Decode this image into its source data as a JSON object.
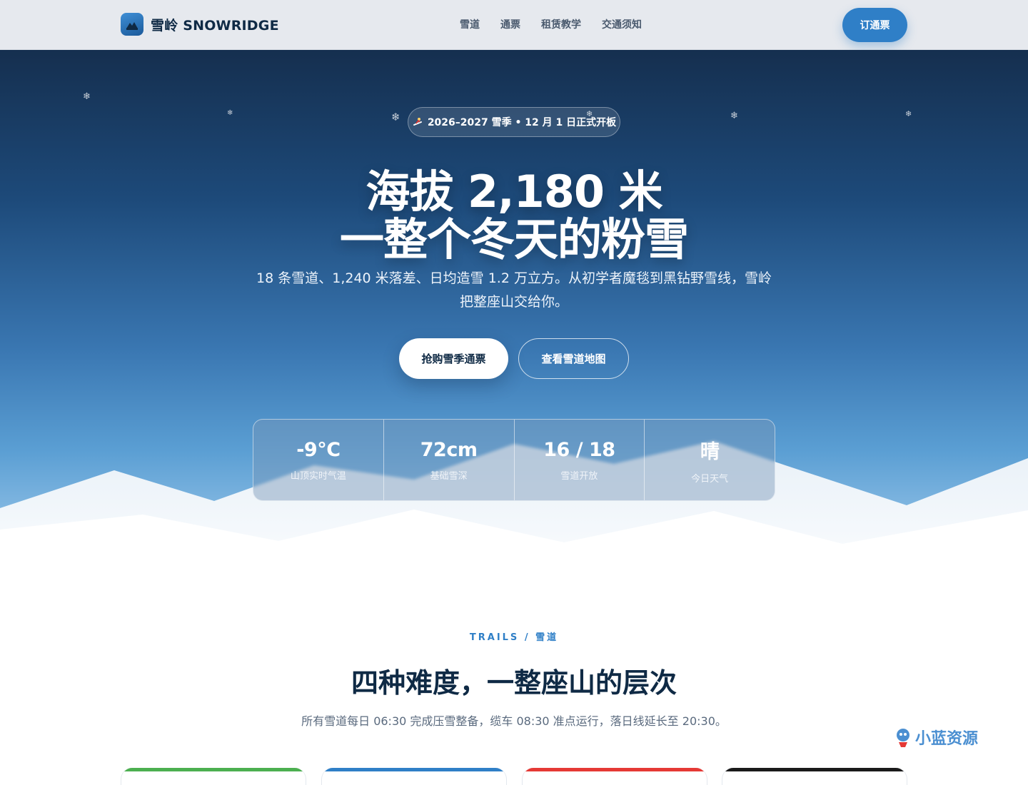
{
  "nav": {
    "brand": "雪岭 SNOWRIDGE",
    "links": [
      "雪道",
      "通票",
      "租赁教学",
      "交通须知"
    ],
    "cta": "订通票"
  },
  "hero": {
    "badge": "2026–2027 雪季 • 12 月 1 日正式开板",
    "title_line1": "海拔 2,180 米",
    "title_line2": "一整个冬天的粉雪",
    "lead": "18 条雪道、1,240 米落差、日均造雪 1.2 万立方。从初学者魔毯到黑钻野雪线，雪岭把整座山交给你。",
    "primary_cta": "抢购雪季通票",
    "secondary_cta": "查看雪道地图",
    "stats": [
      {
        "value": "-9°C",
        "label": "山顶实时气温"
      },
      {
        "value": "72cm",
        "label": "基础雪深"
      },
      {
        "value": "16 / 18",
        "label": "雪道开放"
      },
      {
        "value": "晴",
        "label": "今日天气"
      }
    ]
  },
  "trails": {
    "eyebrow": "TRAILS / 雪道",
    "title": "四种难度，一整座山的层次",
    "subtitle": "所有雪道每日 06:30 完成压雪整备，缆车 08:30 准点运行，落日线延长至 20:30。",
    "card_colors": [
      "#4caf50",
      "#2f7fc7",
      "#e53935",
      "#1a1a1a"
    ]
  },
  "watermark": "小蓝资源",
  "colors": {
    "accent": "#2f7fc7",
    "navy": "#0f2a45"
  }
}
